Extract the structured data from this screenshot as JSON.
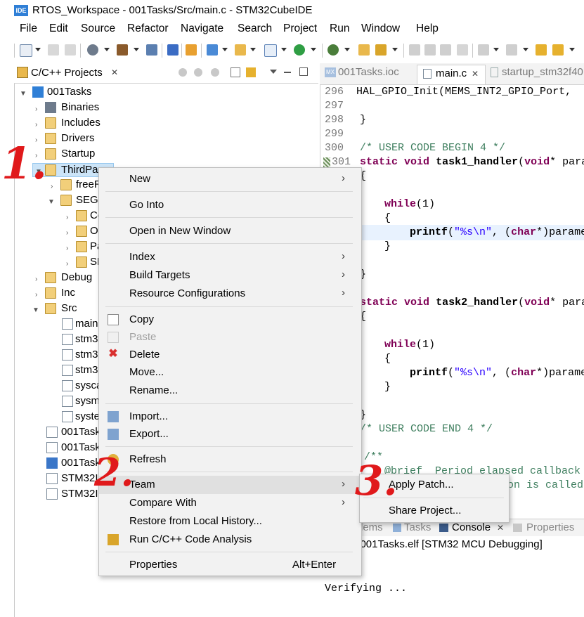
{
  "window": {
    "title": "RTOS_Workspace - 001Tasks/Src/main.c - STM32CubeIDE",
    "logo_text": "IDE"
  },
  "menubar": [
    "File",
    "Edit",
    "Source",
    "Refactor",
    "Navigate",
    "Search",
    "Project",
    "Run",
    "Window",
    "Help"
  ],
  "left_panel": {
    "tab_label": "C/C++ Projects",
    "close": "✕"
  },
  "tree": [
    {
      "label": "001Tasks"
    },
    {
      "label": "Binaries"
    },
    {
      "label": "Includes"
    },
    {
      "label": "Drivers"
    },
    {
      "label": "Startup"
    },
    {
      "label": "ThirdPa"
    },
    {
      "label": "freeR"
    },
    {
      "label": "SEGG"
    },
    {
      "label": "Co"
    },
    {
      "label": "O"
    },
    {
      "label": "Pa"
    },
    {
      "label": "SE"
    },
    {
      "label": "Debug"
    },
    {
      "label": "Inc"
    },
    {
      "label": "Src"
    },
    {
      "label": "main"
    },
    {
      "label": "stm3"
    },
    {
      "label": "stm3"
    },
    {
      "label": "stm3"
    },
    {
      "label": "sysca"
    },
    {
      "label": "sysm"
    },
    {
      "label": "syste"
    },
    {
      "label": "001Task"
    },
    {
      "label": "001Task"
    },
    {
      "label": "001Task"
    },
    {
      "label": "STM32I"
    },
    {
      "label": "STM32I"
    }
  ],
  "editor_tabs": [
    {
      "label": "001Tasks.ioc",
      "icon": "MX"
    },
    {
      "label": "main.c",
      "close": "✕"
    },
    {
      "label": "startup_stm32f40"
    }
  ],
  "code": {
    "l296": {
      "num": "296",
      "text": "  HAL_GPIO_Init(MEMS_INT2_GPIO_Port,"
    },
    "l297": {
      "num": "297"
    },
    "l298": {
      "num": "298",
      "text": "}"
    },
    "l299": {
      "num": "299"
    },
    "l300": {
      "num": "300",
      "text": "/* USER CODE BEGIN 4 */"
    },
    "l301": {
      "num": "301",
      "kw1": "static",
      "kw2": "void",
      "fn": "task1_handler",
      "p1": "(",
      "kw3": "void",
      "rest": "* para"
    },
    "l302": {
      "text": "{"
    },
    "l304": {
      "kw": "while",
      "rest": "(1)"
    },
    "l305": {
      "text": "{"
    },
    "l306": {
      "fn": "printf",
      "p1": "(",
      "str": "\"%s\\n\"",
      "p2": ", (",
      "kw": "char",
      "rest": "*)parame"
    },
    "l307": {
      "text": "}"
    },
    "l309": {
      "text": "}"
    },
    "l311": {
      "kw1": "static",
      "kw2": "void",
      "fn": "task2_handler",
      "p1": "(",
      "kw3": "void",
      "rest": "* para"
    },
    "l312": {
      "text": "{"
    },
    "l314": {
      "kw": "while",
      "rest": "(1)"
    },
    "l315": {
      "text": "{"
    },
    "l316": {
      "fn": "printf",
      "p1": "(",
      "str": "\"%s\\n\"",
      "p2": ", (",
      "kw": "char",
      "rest": "*)parame"
    },
    "l317": {
      "text": "}"
    },
    "l319": {
      "text": "}"
    },
    "l320": {
      "text": "/* USER CODE END 4 */"
    },
    "l322": {
      "text": "/**"
    },
    "l323a": {
      "text": "@brief  Period elapsed callback"
    },
    "l323b": {
      "text": "on is called"
    }
  },
  "console": {
    "tabs": [
      "lems",
      "Tasks",
      "Console",
      "Properties"
    ],
    "close": "✕",
    "header": "nated> 001Tasks.elf [STM32 MCU Debugging]",
    "output": "Verifying ..."
  },
  "context_menu": {
    "new": "New",
    "go_into": "Go Into",
    "open_new_window": "Open in New Window",
    "index": "Index",
    "build_targets": "Build Targets",
    "resource_configs": "Resource Configurations",
    "copy": "Copy",
    "paste": "Paste",
    "delete": "Delete",
    "move": "Move...",
    "rename": "Rename...",
    "import": "Import...",
    "export": "Export...",
    "refresh": "Refresh",
    "team": "Team",
    "compare_with": "Compare With",
    "restore_history": "Restore from Local History...",
    "run_analysis": "Run C/C++ Code Analysis",
    "properties": "Properties",
    "properties_shortcut": "Alt+Enter",
    "arrow": "›"
  },
  "submenu": {
    "apply_patch": "Apply Patch...",
    "share_project": "Share Project..."
  },
  "annotations": {
    "a1": "1.",
    "a2": "2.",
    "a3": "3."
  },
  "colors": {
    "annotation": "#e0191b",
    "keyword": "#7f0055",
    "string": "#2a00ff",
    "comment": "#3f7f5f"
  }
}
